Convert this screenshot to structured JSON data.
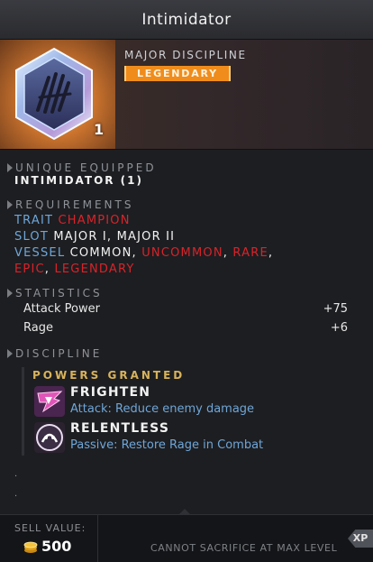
{
  "item": {
    "title": "Intimidator",
    "type": "MAJOR DISCIPLINE",
    "rarity": "LEGENDARY",
    "count": "1",
    "icon": "discipline-claw-icon"
  },
  "unique": {
    "header": "UNIQUE EQUIPPED",
    "value": "INTIMIDATOR (1)"
  },
  "requirements": {
    "header": "REQUIREMENTS",
    "trait_label": "TRAIT",
    "trait_value": "CHAMPION",
    "slot_label": "SLOT",
    "slot_value": "MAJOR I, MAJOR II",
    "vessel_label": "VESSEL",
    "vessel_common": "COMMON,",
    "vessel_uncommon": "UNCOMMON",
    "vessel_rare": "RARE",
    "vessel_epic": "EPIC",
    "vessel_legendary": "LEGENDARY"
  },
  "statistics": {
    "header": "STATISTICS",
    "rows": [
      {
        "name": "Attack Power",
        "value": "+75"
      },
      {
        "name": "Rage",
        "value": "+6"
      }
    ]
  },
  "discipline": {
    "header": "DISCIPLINE",
    "powers_title": "POWERS GRANTED",
    "powers": [
      {
        "name": "FRIGHTEN",
        "desc": "Attack: Reduce enemy damage",
        "icon": "frighten-icon"
      },
      {
        "name": "RELENTLESS",
        "desc": "Passive: Restore Rage in Combat",
        "icon": "relentless-icon"
      }
    ]
  },
  "footer": {
    "sell_label": "SELL VALUE:",
    "sell_value": "500",
    "note": "CANNOT SACRIFICE AT MAX LEVEL",
    "xp_label": "XP"
  },
  "colors": {
    "legendary": "#f08c1c",
    "requirement_label": "#6fa6d8",
    "unmet": "#d9232a",
    "powers_title": "#d8b35c"
  }
}
